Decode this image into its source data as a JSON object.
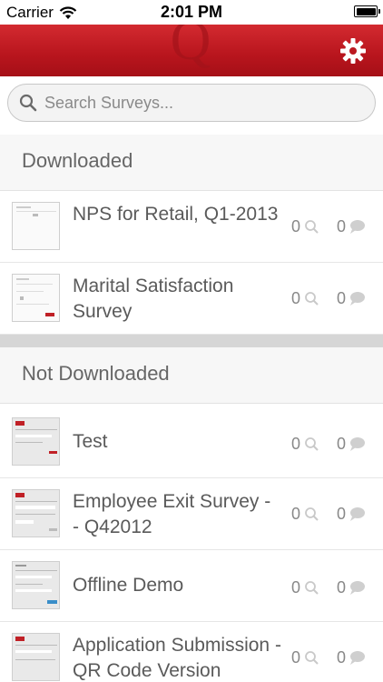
{
  "status_bar": {
    "carrier": "Carrier",
    "time": "2:01 PM"
  },
  "header": {
    "logo_letter": "Q",
    "settings_icon": "gear-icon",
    "brand_color": "#c01f26"
  },
  "search": {
    "placeholder": "Search Surveys..."
  },
  "sections": {
    "downloaded": {
      "label": "Downloaded",
      "surveys": [
        {
          "title": "NPS for Retail, Q1-2013",
          "responses": "0",
          "comments": "0"
        },
        {
          "title": "Marital Satisfaction Survey",
          "responses": "0",
          "comments": "0"
        }
      ]
    },
    "not_downloaded": {
      "label": "Not Downloaded",
      "surveys": [
        {
          "title": "Test",
          "responses": "0",
          "comments": "0"
        },
        {
          "title": "Employee Exit Survey - - Q42012",
          "responses": "0",
          "comments": "0"
        },
        {
          "title": "Offline Demo",
          "responses": "0",
          "comments": "0"
        },
        {
          "title": "Application Submission - QR Code Version",
          "responses": "0",
          "comments": "0"
        }
      ]
    }
  }
}
